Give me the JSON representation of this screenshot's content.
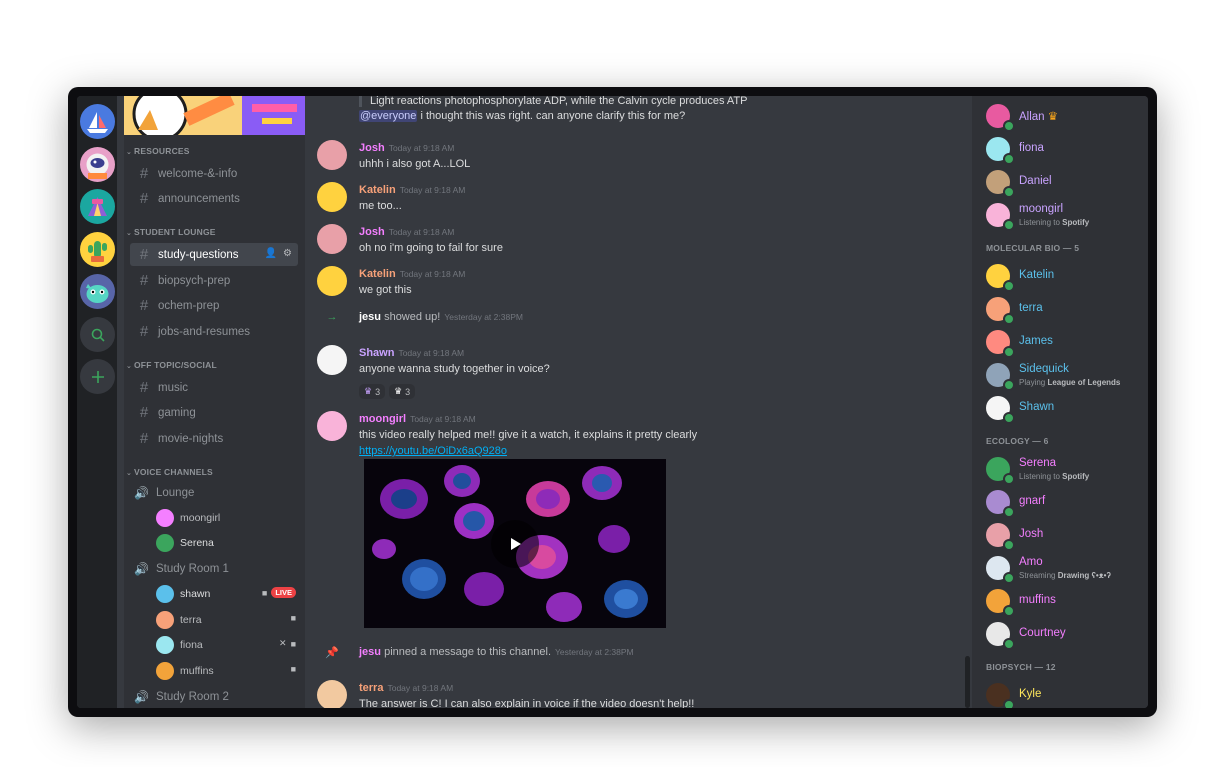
{
  "servers": [
    "sailboat-server",
    "astronaut-server",
    "tent-server",
    "cactus-server",
    "creature-server"
  ],
  "rail_actions": {
    "explore": "search-icon",
    "add": "plus-icon"
  },
  "channel_sidebar": {
    "categories": [
      {
        "name": "RESOURCES",
        "channels": [
          "welcome-&-info",
          "announcements"
        ]
      },
      {
        "name": "STUDENT LOUNGE",
        "channels": [
          "study-questions",
          "biopsych-prep",
          "ochem-prep",
          "jobs-and-resumes"
        ],
        "active": "study-questions"
      },
      {
        "name": "OFF TOPIC/SOCIAL",
        "channels": [
          "music",
          "gaming",
          "movie-nights"
        ]
      },
      {
        "name": "VOICE CHANNELS"
      }
    ],
    "voice": [
      {
        "name": "Lounge",
        "users": [
          "moongirl",
          "Serena"
        ]
      },
      {
        "name": "Study Room 1",
        "users": [
          "shawn",
          "terra",
          "fiona",
          "muffins"
        ],
        "live_badge": "LIVE"
      },
      {
        "name": "Study Room 2",
        "users": []
      }
    ]
  },
  "chat": {
    "quote_text": "Light reactions photophosphorylate ADP, while the Calvin cycle produces ATP",
    "everyone_mention": "@everyone",
    "everyone_text": " i thought this was right. can anyone clarify this for me?",
    "messages": [
      {
        "author": "Josh",
        "time": "Today at 9:18 AM",
        "text": "uhhh i also got A...LOL",
        "color": "#f47fff"
      },
      {
        "author": "Katelin",
        "time": "Today at 9:18 AM",
        "text": "me too...",
        "color": "#f7a179"
      },
      {
        "author": "Josh",
        "time": "Today at 9:18 AM",
        "text": "oh no i'm going to fail for sure",
        "color": "#f47fff"
      },
      {
        "author": "Katelin",
        "time": "Today at 9:18 AM",
        "text": "we got this",
        "color": "#f7a179"
      },
      {
        "author": "Shawn",
        "time": "Today at 9:18 AM",
        "text": "anyone wanna study together in voice?",
        "color": "#c9a3ff"
      },
      {
        "author": "moongirl",
        "time": "Today at 9:18 AM",
        "text": "this video really helped me!! give it a watch, it explains it pretty clearly",
        "color": "#f47fff"
      },
      {
        "author": "terra",
        "time": "Today at 9:18 AM",
        "text": "The answer is C! I can also explain in voice if the video doesn't help!!",
        "color": "#f7a179"
      }
    ],
    "system_join": {
      "user": "jesu",
      "text": " showed up!",
      "time": "Yesterday at 2:38PM"
    },
    "system_pin": {
      "user": "jesu",
      "text": " pinned a message to this channel.",
      "time": "Yesterday at 2:38PM"
    },
    "reactions": [
      {
        "count": "3"
      },
      {
        "count": "3"
      }
    ],
    "link": "https://youtu.be/OiDx6aQ928o"
  },
  "members": {
    "online": [
      {
        "name": "Allan",
        "color": "#c9a3ff",
        "crown": true
      },
      {
        "name": "fiona",
        "color": "#c9a3ff"
      },
      {
        "name": "Daniel",
        "color": "#c9a3ff"
      },
      {
        "name": "moongirl",
        "color": "#c9a3ff",
        "activity_pre": "Listening to ",
        "activity": "Spotify"
      }
    ],
    "groups": [
      {
        "title": "MOLECULAR BIO — 5",
        "members": [
          {
            "name": "Katelin",
            "color": "#5bc0eb"
          },
          {
            "name": "terra",
            "color": "#5bc0eb"
          },
          {
            "name": "James",
            "color": "#5bc0eb"
          },
          {
            "name": "Sidequick",
            "color": "#5bc0eb",
            "activity_pre": "Playing ",
            "activity": "League of Legends"
          },
          {
            "name": "Shawn",
            "color": "#5bc0eb"
          }
        ]
      },
      {
        "title": "ECOLOGY — 6",
        "members": [
          {
            "name": "Serena",
            "color": "#f47fff",
            "activity_pre": "Listening to ",
            "activity": "Spotify"
          },
          {
            "name": "gnarf",
            "color": "#f47fff"
          },
          {
            "name": "Josh",
            "color": "#f47fff"
          },
          {
            "name": "Amo",
            "color": "#f47fff",
            "activity_pre": "Streaming ",
            "activity": "Drawing ʕ•ᴥ•ʔ"
          },
          {
            "name": "muffins",
            "color": "#f47fff"
          },
          {
            "name": "Courtney",
            "color": "#f47fff"
          }
        ]
      },
      {
        "title": "BIOPSYCH — 12",
        "members": [
          {
            "name": "Kyle",
            "color": "#fee75c"
          }
        ]
      }
    ]
  }
}
